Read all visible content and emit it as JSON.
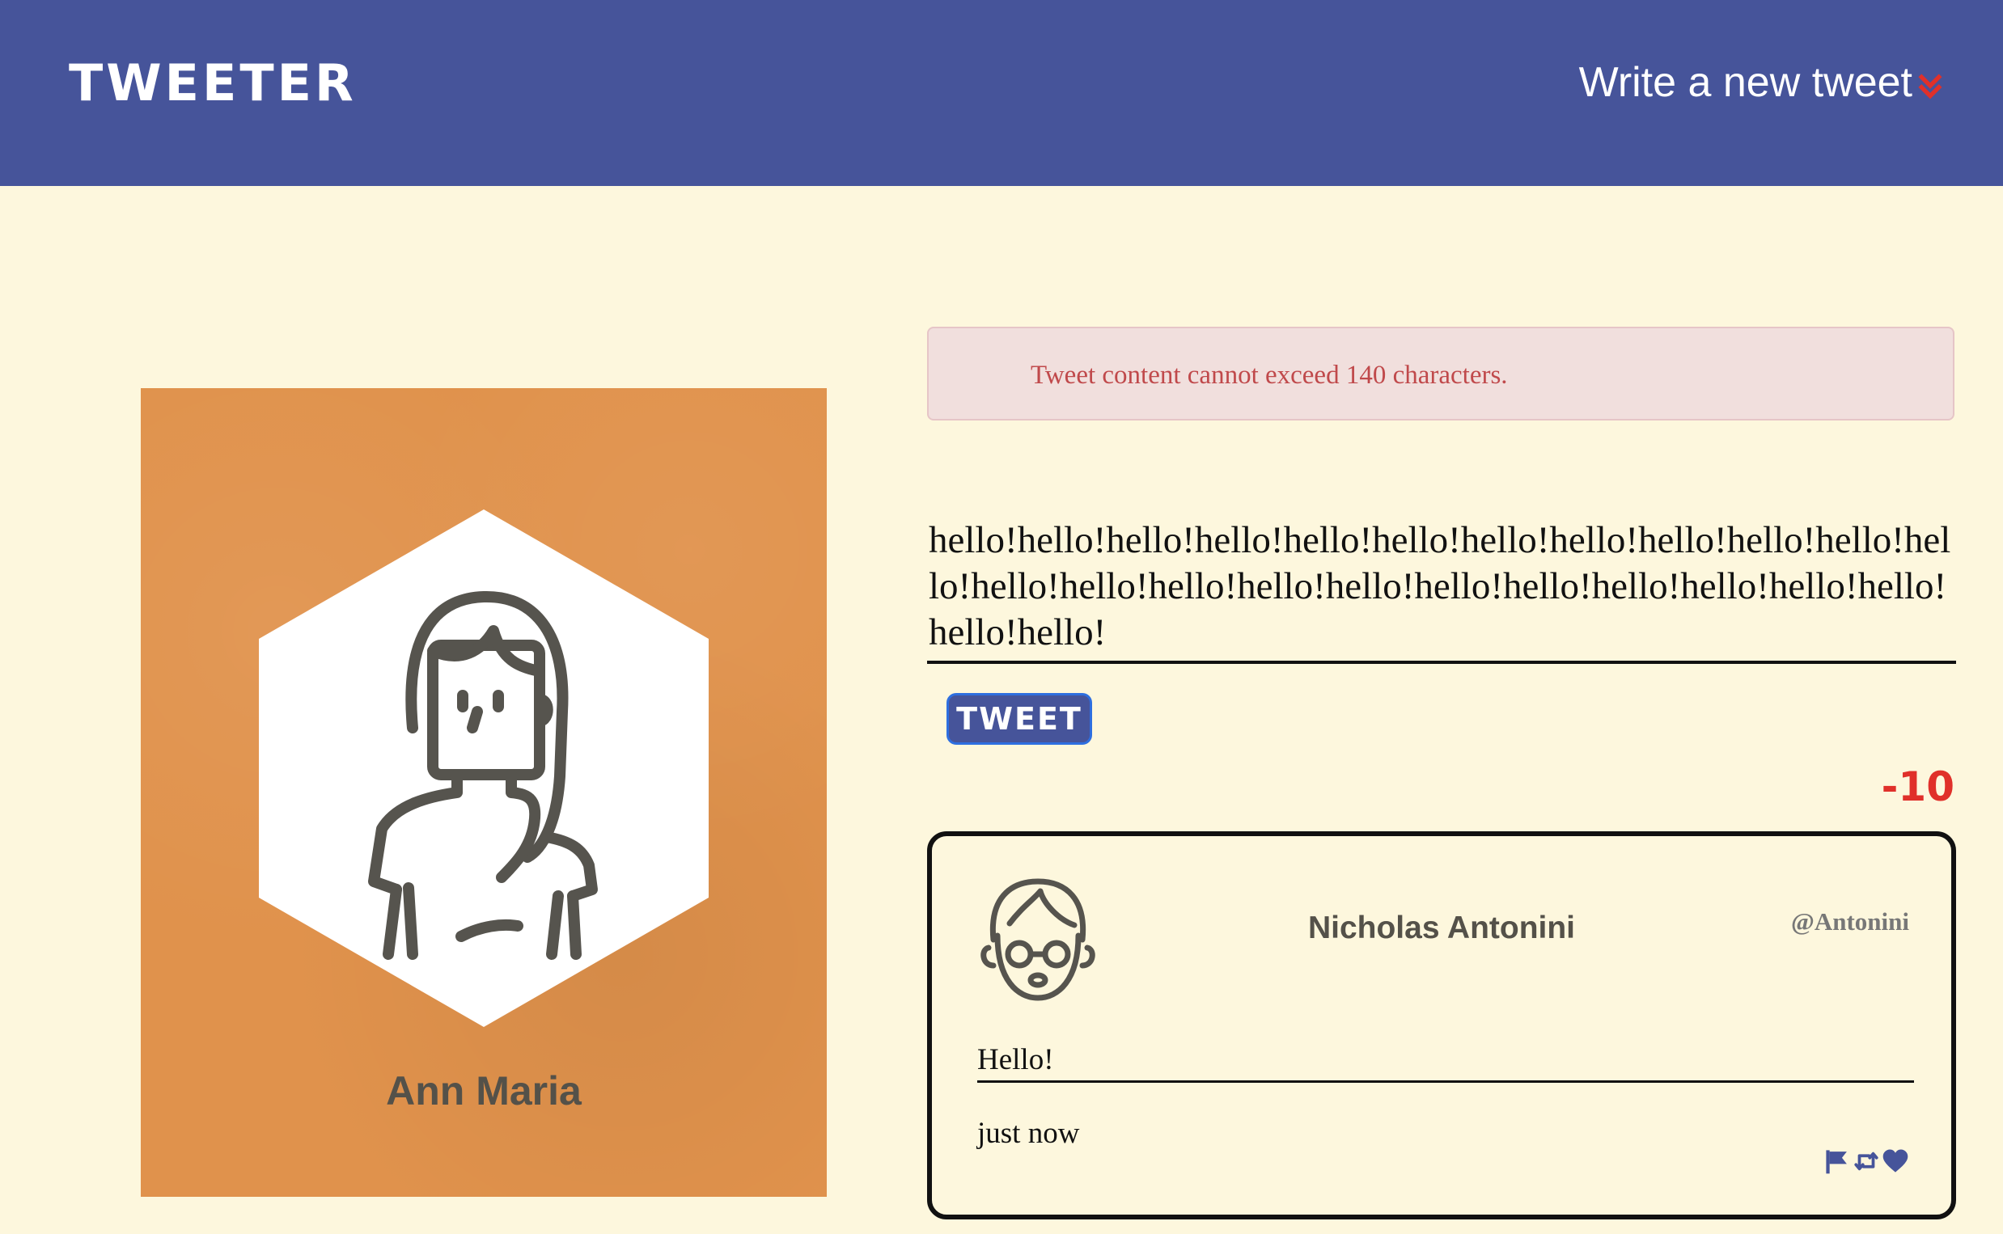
{
  "header": {
    "brand": "TWEETER",
    "compose_label": "Write a new tweet",
    "compose_icon": "double-chevron-down-icon"
  },
  "profile": {
    "name": "Ann Maria",
    "card_color": "#e0924c"
  },
  "composer": {
    "error": "Tweet content cannot exceed 140 characters.",
    "text": "hello!hello!hello!hello!hello!hello!hello!hello!hello!hello!hello!hello!hello!hello!hello!hello!hello!hello!hello!hello!hello!hello!hello!hello!hello!",
    "tweet_button": "TWEET",
    "counter": "-10"
  },
  "tweet": {
    "author": "Nicholas Antonini",
    "handle": "@Antonini",
    "content": "Hello!",
    "timestamp": "just now",
    "actions": [
      "flag-icon",
      "retweet-icon",
      "heart-icon"
    ]
  },
  "colors": {
    "header_bg": "#46549a",
    "page_bg": "#fdf7dd",
    "error_text": "#c0494b",
    "counter": "#e0302a"
  }
}
